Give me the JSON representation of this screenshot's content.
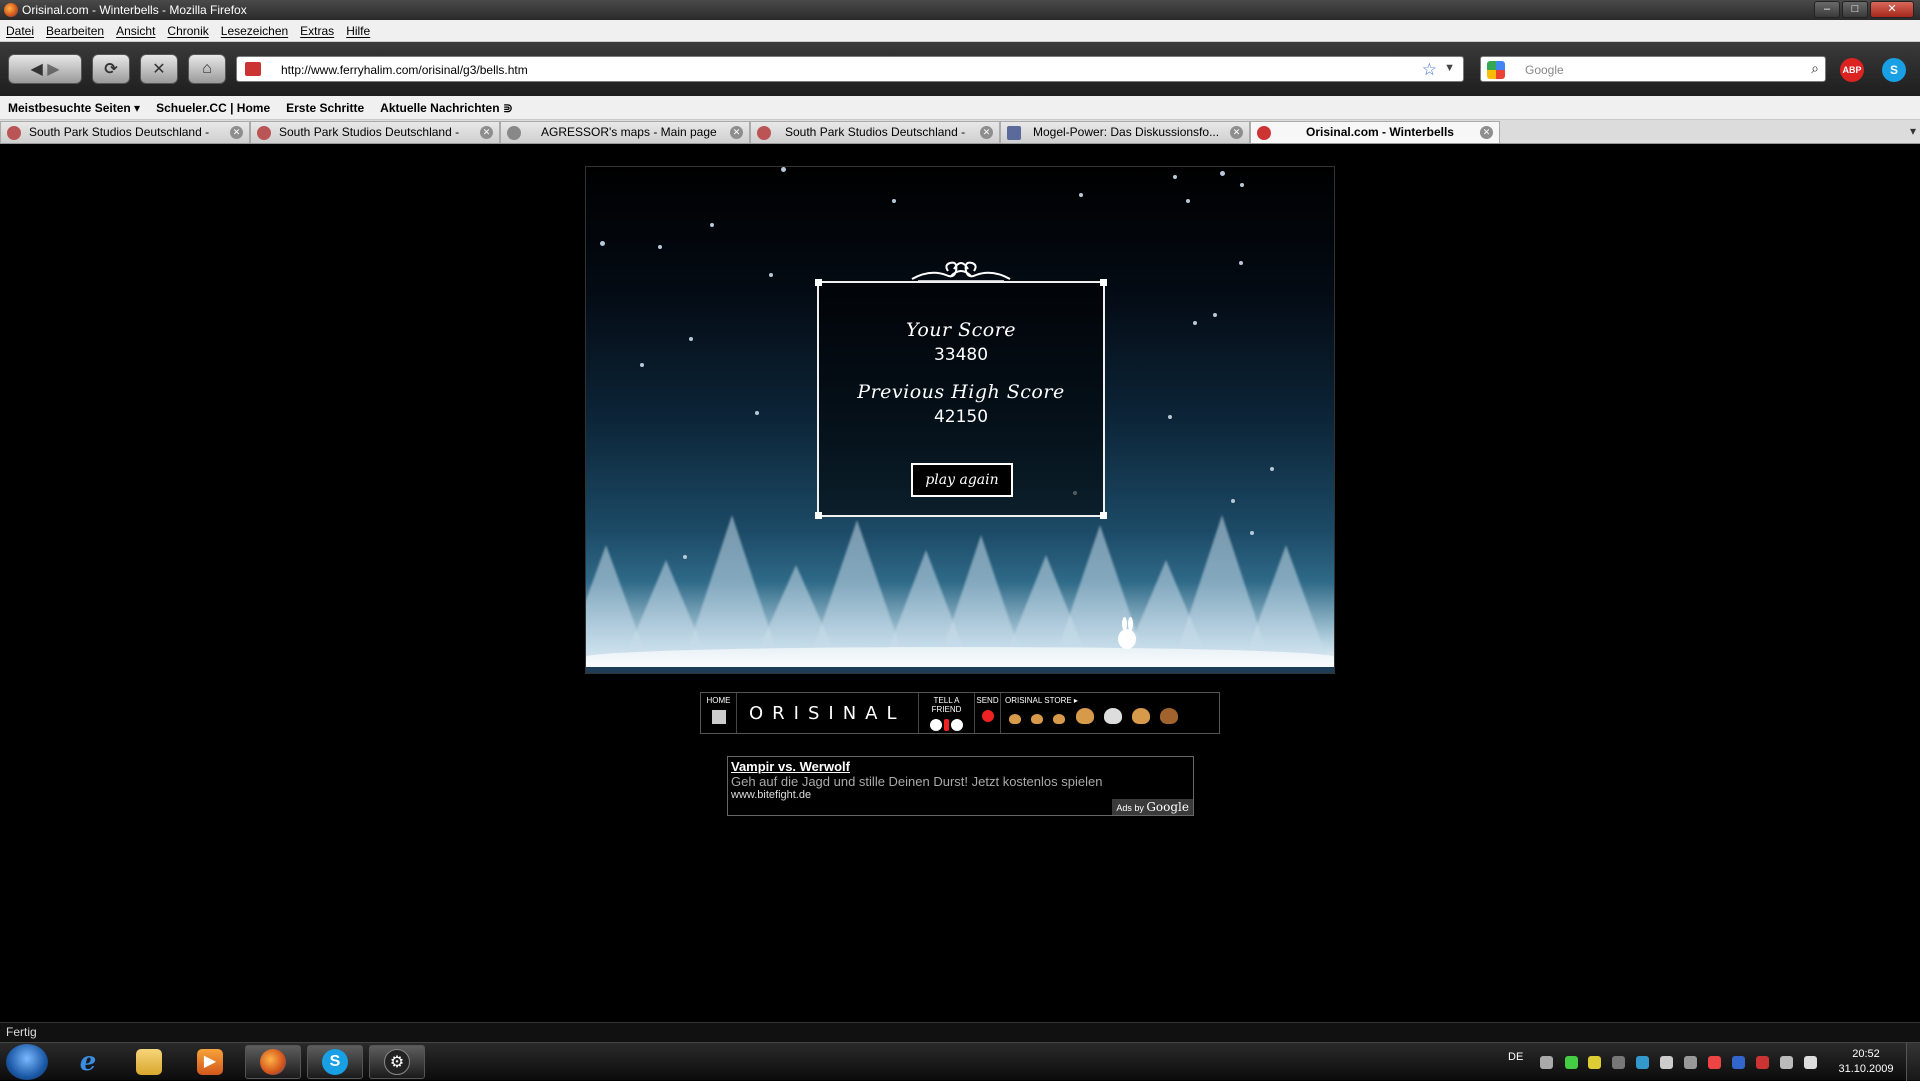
{
  "window": {
    "title": "Orisinal.com - Winterbells - Mozilla Firefox",
    "controls": {
      "minimize": "–",
      "maximize": "□",
      "close": "✕"
    }
  },
  "menu": [
    "Datei",
    "Bearbeiten",
    "Ansicht",
    "Chronik",
    "Lesezeichen",
    "Extras",
    "Hilfe"
  ],
  "navbar": {
    "url": "http://www.ferryhalim.com/orisinal/g3/bells.htm",
    "search_placeholder": "Google",
    "abp_label": "ABP"
  },
  "bookmarks": [
    "Meistbesuchte Seiten ▾",
    "Schueler.CC | Home",
    "Erste Schritte",
    "Aktuelle Nachrichten ⋑"
  ],
  "tabs": [
    {
      "label": "South Park Studios Deutschland -",
      "icon": "southpark-icon"
    },
    {
      "label": "South Park Studios Deutschland -",
      "icon": "southpark-icon"
    },
    {
      "label": "AGRESSOR's maps - Main page",
      "icon": "agressor-icon"
    },
    {
      "label": "South Park Studios Deutschland -",
      "icon": "southpark-icon"
    },
    {
      "label": "Mogel-Power: Das Diskussionsfo...",
      "icon": "mogelpower-icon"
    },
    {
      "label": "Orisinal.com - Winterbells",
      "icon": "orisinal-icon",
      "active": true
    }
  ],
  "game": {
    "your_score_label": "Your Score",
    "your_score": "33480",
    "previous_high_label": "Previous High Score",
    "previous_high": "42150",
    "play_again": "play again"
  },
  "orisinal_nav": {
    "home": "HOME",
    "brand": "ORISINAL",
    "tell_a_friend": "TELL A FRIEND",
    "send": "SEND",
    "store": "ORISINAL STORE ▸"
  },
  "ad": {
    "title": "Vampir vs. Werwolf",
    "text": "Geh auf die Jagd und stille Deinen Durst! Jetzt kostenlos spielen",
    "url": "www.bitefight.de",
    "ads_by": "Ads by",
    "google": "Google"
  },
  "status": "Fertig",
  "taskbar": {
    "language": "DE",
    "time": "20:52",
    "date": "31.10.2009"
  }
}
